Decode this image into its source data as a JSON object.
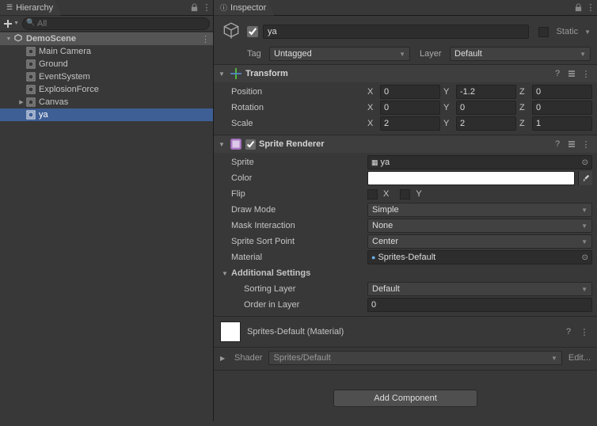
{
  "hierarchy": {
    "tab_label": "Hierarchy",
    "search_placeholder": "All",
    "scene_name": "DemoScene",
    "items": [
      {
        "name": "Main Camera"
      },
      {
        "name": "Ground"
      },
      {
        "name": "EventSystem"
      },
      {
        "name": "ExplosionForce"
      },
      {
        "name": "Canvas"
      },
      {
        "name": "ya"
      }
    ]
  },
  "inspector": {
    "tab_label": "Inspector",
    "gameobject": {
      "name": "ya",
      "enabled": true,
      "static_label": "Static",
      "tag_label": "Tag",
      "tag_value": "Untagged",
      "layer_label": "Layer",
      "layer_value": "Default"
    },
    "transform": {
      "title": "Transform",
      "position_label": "Position",
      "position": {
        "x": "0",
        "y": "-1.2",
        "z": "0"
      },
      "rotation_label": "Rotation",
      "rotation": {
        "x": "0",
        "y": "0",
        "z": "0"
      },
      "scale_label": "Scale",
      "scale": {
        "x": "2",
        "y": "2",
        "z": "1"
      }
    },
    "sprite_renderer": {
      "title": "Sprite Renderer",
      "sprite_label": "Sprite",
      "sprite_value": "ya",
      "color_label": "Color",
      "color_value": "#FFFFFF",
      "flip_label": "Flip",
      "flip_x_label": "X",
      "flip_y_label": "Y",
      "draw_mode_label": "Draw Mode",
      "draw_mode_value": "Simple",
      "mask_label": "Mask Interaction",
      "mask_value": "None",
      "sort_point_label": "Sprite Sort Point",
      "sort_point_value": "Center",
      "material_label": "Material",
      "material_value": "Sprites-Default",
      "additional_title": "Additional Settings",
      "sorting_layer_label": "Sorting Layer",
      "sorting_layer_value": "Default",
      "order_label": "Order in Layer",
      "order_value": "0"
    },
    "material_section": {
      "name": "Sprites-Default (Material)",
      "shader_label": "Shader",
      "shader_value": "Sprites/Default",
      "edit_label": "Edit..."
    },
    "add_component_label": "Add Component"
  }
}
